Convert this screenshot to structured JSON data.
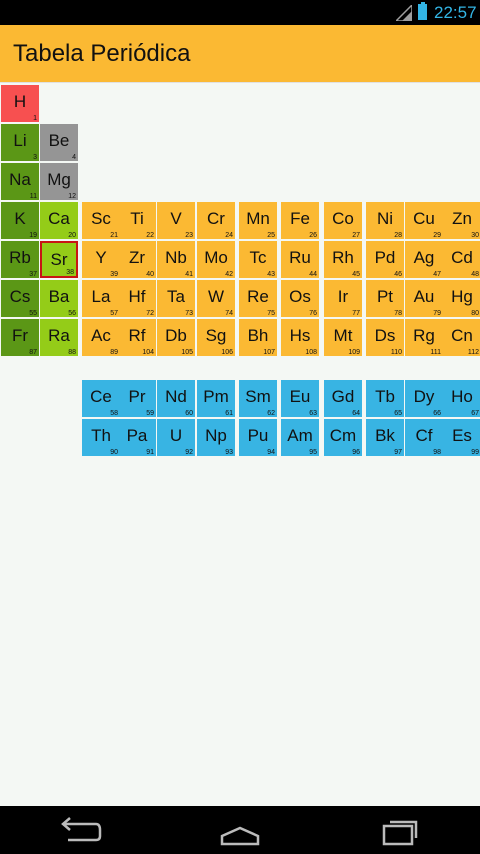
{
  "status_bar": {
    "time": "22:57",
    "icons": [
      "signal-icon",
      "battery-icon"
    ]
  },
  "app_bar": {
    "title": "Tabela Periódica"
  },
  "colors": {
    "hydrogen": "#f75050",
    "alkali": "#5b9716",
    "alkaline_earth": "#94cc18",
    "beryllium_group_light": "#959595",
    "transition": "#fbb933",
    "f_block": "#38b4e3",
    "selected_border": "#c81414"
  },
  "selected": "Sr",
  "elements": [
    {
      "sym": "H",
      "num": "1",
      "group": "hydrogen",
      "col": 0,
      "row": 0
    },
    {
      "sym": "Li",
      "num": "3",
      "group": "alkali",
      "col": 0,
      "row": 1
    },
    {
      "sym": "Be",
      "num": "4",
      "group": "beryllium_group_light",
      "col": 1,
      "row": 1
    },
    {
      "sym": "Na",
      "num": "11",
      "group": "alkali",
      "col": 0,
      "row": 2
    },
    {
      "sym": "Mg",
      "num": "12",
      "group": "beryllium_group_light",
      "col": 1,
      "row": 2
    },
    {
      "sym": "K",
      "num": "19",
      "group": "alkali",
      "col": 0,
      "row": 3
    },
    {
      "sym": "Ca",
      "num": "20",
      "group": "alkaline_earth",
      "col": 1,
      "row": 3
    },
    {
      "sym": "Sc",
      "num": "21",
      "group": "transition",
      "col": 2,
      "row": 3
    },
    {
      "sym": "Ti",
      "num": "22",
      "group": "transition",
      "col": 3,
      "row": 3
    },
    {
      "sym": "V",
      "num": "23",
      "group": "transition",
      "col": 4,
      "row": 3
    },
    {
      "sym": "Cr",
      "num": "24",
      "group": "transition",
      "col": 5,
      "row": 3
    },
    {
      "sym": "Mn",
      "num": "25",
      "group": "transition",
      "col": 6,
      "row": 3
    },
    {
      "sym": "Fe",
      "num": "26",
      "group": "transition",
      "col": 7,
      "row": 3
    },
    {
      "sym": "Co",
      "num": "27",
      "group": "transition",
      "col": 8,
      "row": 3
    },
    {
      "sym": "Ni",
      "num": "28",
      "group": "transition",
      "col": 9,
      "row": 3
    },
    {
      "sym": "Cu",
      "num": "29",
      "group": "transition",
      "col": 10,
      "row": 3
    },
    {
      "sym": "Zn",
      "num": "30",
      "group": "transition",
      "col": 11,
      "row": 3
    },
    {
      "sym": "Rb",
      "num": "37",
      "group": "alkali",
      "col": 0,
      "row": 4
    },
    {
      "sym": "Sr",
      "num": "38",
      "group": "alkaline_earth",
      "col": 1,
      "row": 4
    },
    {
      "sym": "Y",
      "num": "39",
      "group": "transition",
      "col": 2,
      "row": 4
    },
    {
      "sym": "Zr",
      "num": "40",
      "group": "transition",
      "col": 3,
      "row": 4
    },
    {
      "sym": "Nb",
      "num": "41",
      "group": "transition",
      "col": 4,
      "row": 4
    },
    {
      "sym": "Mo",
      "num": "42",
      "group": "transition",
      "col": 5,
      "row": 4
    },
    {
      "sym": "Tc",
      "num": "43",
      "group": "transition",
      "col": 6,
      "row": 4
    },
    {
      "sym": "Ru",
      "num": "44",
      "group": "transition",
      "col": 7,
      "row": 4
    },
    {
      "sym": "Rh",
      "num": "45",
      "group": "transition",
      "col": 8,
      "row": 4
    },
    {
      "sym": "Pd",
      "num": "46",
      "group": "transition",
      "col": 9,
      "row": 4
    },
    {
      "sym": "Ag",
      "num": "47",
      "group": "transition",
      "col": 10,
      "row": 4
    },
    {
      "sym": "Cd",
      "num": "48",
      "group": "transition",
      "col": 11,
      "row": 4
    },
    {
      "sym": "Cs",
      "num": "55",
      "group": "alkali",
      "col": 0,
      "row": 5
    },
    {
      "sym": "Ba",
      "num": "56",
      "group": "alkaline_earth",
      "col": 1,
      "row": 5
    },
    {
      "sym": "La",
      "num": "57",
      "group": "transition",
      "col": 2,
      "row": 5
    },
    {
      "sym": "Hf",
      "num": "72",
      "group": "transition",
      "col": 3,
      "row": 5
    },
    {
      "sym": "Ta",
      "num": "73",
      "group": "transition",
      "col": 4,
      "row": 5
    },
    {
      "sym": "W",
      "num": "74",
      "group": "transition",
      "col": 5,
      "row": 5
    },
    {
      "sym": "Re",
      "num": "75",
      "group": "transition",
      "col": 6,
      "row": 5
    },
    {
      "sym": "Os",
      "num": "76",
      "group": "transition",
      "col": 7,
      "row": 5
    },
    {
      "sym": "Ir",
      "num": "77",
      "group": "transition",
      "col": 8,
      "row": 5
    },
    {
      "sym": "Pt",
      "num": "78",
      "group": "transition",
      "col": 9,
      "row": 5
    },
    {
      "sym": "Au",
      "num": "79",
      "group": "transition",
      "col": 10,
      "row": 5
    },
    {
      "sym": "Hg",
      "num": "80",
      "group": "transition",
      "col": 11,
      "row": 5
    },
    {
      "sym": "Fr",
      "num": "87",
      "group": "alkali",
      "col": 0,
      "row": 6
    },
    {
      "sym": "Ra",
      "num": "88",
      "group": "alkaline_earth",
      "col": 1,
      "row": 6
    },
    {
      "sym": "Ac",
      "num": "89",
      "group": "transition",
      "col": 2,
      "row": 6
    },
    {
      "sym": "Rf",
      "num": "104",
      "group": "transition",
      "col": 3,
      "row": 6
    },
    {
      "sym": "Db",
      "num": "105",
      "group": "transition",
      "col": 4,
      "row": 6
    },
    {
      "sym": "Sg",
      "num": "106",
      "group": "transition",
      "col": 5,
      "row": 6
    },
    {
      "sym": "Bh",
      "num": "107",
      "group": "transition",
      "col": 6,
      "row": 6
    },
    {
      "sym": "Hs",
      "num": "108",
      "group": "transition",
      "col": 7,
      "row": 6
    },
    {
      "sym": "Mt",
      "num": "109",
      "group": "transition",
      "col": 8,
      "row": 6
    },
    {
      "sym": "Ds",
      "num": "110",
      "group": "transition",
      "col": 9,
      "row": 6
    },
    {
      "sym": "Rg",
      "num": "111",
      "group": "transition",
      "col": 10,
      "row": 6
    },
    {
      "sym": "Cn",
      "num": "112",
      "group": "transition",
      "col": 11,
      "row": 6
    },
    {
      "sym": "Ce",
      "num": "58",
      "group": "f_block",
      "col": 2,
      "row": 7
    },
    {
      "sym": "Pr",
      "num": "59",
      "group": "f_block",
      "col": 3,
      "row": 7
    },
    {
      "sym": "Nd",
      "num": "60",
      "group": "f_block",
      "col": 4,
      "row": 7
    },
    {
      "sym": "Pm",
      "num": "61",
      "group": "f_block",
      "col": 5,
      "row": 7
    },
    {
      "sym": "Sm",
      "num": "62",
      "group": "f_block",
      "col": 6,
      "row": 7
    },
    {
      "sym": "Eu",
      "num": "63",
      "group": "f_block",
      "col": 7,
      "row": 7
    },
    {
      "sym": "Gd",
      "num": "64",
      "group": "f_block",
      "col": 8,
      "row": 7
    },
    {
      "sym": "Tb",
      "num": "65",
      "group": "f_block",
      "col": 9,
      "row": 7
    },
    {
      "sym": "Dy",
      "num": "66",
      "group": "f_block",
      "col": 10,
      "row": 7
    },
    {
      "sym": "Ho",
      "num": "67",
      "group": "f_block",
      "col": 11,
      "row": 7
    },
    {
      "sym": "Th",
      "num": "90",
      "group": "f_block",
      "col": 2,
      "row": 8
    },
    {
      "sym": "Pa",
      "num": "91",
      "group": "f_block",
      "col": 3,
      "row": 8
    },
    {
      "sym": "U",
      "num": "92",
      "group": "f_block",
      "col": 4,
      "row": 8
    },
    {
      "sym": "Np",
      "num": "93",
      "group": "f_block",
      "col": 5,
      "row": 8
    },
    {
      "sym": "Pu",
      "num": "94",
      "group": "f_block",
      "col": 6,
      "row": 8
    },
    {
      "sym": "Am",
      "num": "95",
      "group": "f_block",
      "col": 7,
      "row": 8
    },
    {
      "sym": "Cm",
      "num": "96",
      "group": "f_block",
      "col": 8,
      "row": 8
    },
    {
      "sym": "Bk",
      "num": "97",
      "group": "f_block",
      "col": 9,
      "row": 8
    },
    {
      "sym": "Cf",
      "num": "98",
      "group": "f_block",
      "col": 10,
      "row": 8
    },
    {
      "sym": "Es",
      "num": "99",
      "group": "f_block",
      "col": 11,
      "row": 8
    }
  ],
  "nav_bar": {
    "buttons": [
      "back-icon",
      "home-icon",
      "recent-apps-icon"
    ]
  }
}
